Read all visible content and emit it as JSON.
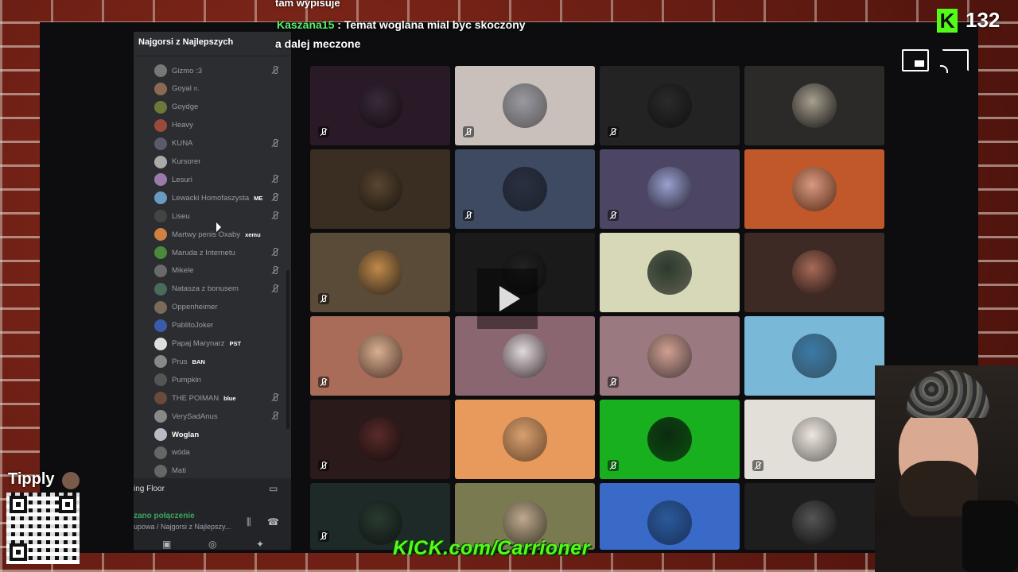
{
  "chat": {
    "line1": "tam wypisuje",
    "line2_user": "Kaszana15",
    "line2_sep": " : ",
    "line2_text": "Temat woglana mial byc skoczony",
    "line3": "a dalej meczone"
  },
  "stream": {
    "viewer_count": "132",
    "kick_logo": "K",
    "url": "KICK.com/Carrioner",
    "tipply": "Tipply"
  },
  "sidebar": {
    "server_title": "Najgorsi z Najlepszych",
    "members": [
      {
        "name": "Gizmo :3",
        "muted": true,
        "color": "#777"
      },
      {
        "name": "Goyal 𝔫.",
        "muted": false,
        "color": "#8a6a55"
      },
      {
        "name": "Goydge",
        "muted": false,
        "color": "#6a7a3a"
      },
      {
        "name": "Heavy",
        "muted": false,
        "color": "#9a4a3a"
      },
      {
        "name": "KUNA",
        "muted": true,
        "color": "#5a5a6a"
      },
      {
        "name": "Kursorer",
        "muted": false,
        "color": "#aaa"
      },
      {
        "name": "Lesuri",
        "muted": true,
        "color": "#9a7aaa"
      },
      {
        "name": "Lewacki Homofaszysta",
        "muted": true,
        "color": "#6a9abf",
        "tag": "ME"
      },
      {
        "name": "Liseu",
        "muted": true,
        "color": "#444"
      },
      {
        "name": "Martwy penis Oxaby",
        "muted": false,
        "color": "#d08040",
        "tag": "xemu"
      },
      {
        "name": "Maruda z Internetu",
        "muted": true,
        "color": "#4a8a3a"
      },
      {
        "name": "Mikele",
        "muted": true,
        "color": "#6a6a6a"
      },
      {
        "name": "Natasza z bonusem",
        "muted": true,
        "color": "#4a6a5a"
      },
      {
        "name": "Oppenheimer",
        "muted": false,
        "color": "#7a6a5a"
      },
      {
        "name": "PablitoJoker",
        "muted": false,
        "color": "#3a5aaa"
      },
      {
        "name": "Papaj Marynarz",
        "muted": false,
        "color": "#ddd",
        "tag": "PST"
      },
      {
        "name": "Prus",
        "muted": false,
        "color": "#888",
        "tag": "BAN"
      },
      {
        "name": "Pumpkin",
        "muted": false,
        "color": "#555"
      },
      {
        "name": "THE POIMAN",
        "muted": true,
        "color": "#6a4a3a",
        "tag": "blue"
      },
      {
        "name": "VerySadAnus",
        "muted": true,
        "color": "#888"
      },
      {
        "name": "Woglan",
        "muted": false,
        "color": "#b8bcc4",
        "bold": true
      },
      {
        "name": "wóda",
        "muted": false,
        "color": "#666"
      },
      {
        "name": "Mati",
        "muted": false,
        "color": "#666"
      }
    ],
    "stage_label": "ing Floor",
    "connection_status": "zano połączenie",
    "connection_channel": "upowa / Najgorsi z Najlepszy..."
  },
  "tiles": [
    {
      "bg": "#2a1a28",
      "av": "#3a2a3a",
      "muted": true
    },
    {
      "bg": "#c9c0bb",
      "av": "#9a9aa2",
      "muted": true
    },
    {
      "bg": "#232323",
      "av": "#2b2b2b",
      "muted": true
    },
    {
      "bg": "#2b2a28",
      "av": "#a8a090",
      "muted": false
    },
    {
      "bg": "#3a2e22",
      "av": "#5a4630",
      "muted": false
    },
    {
      "bg": "#3e4a62",
      "av": "#2a3040",
      "muted": true
    },
    {
      "bg": "#4c4664",
      "av": "#9aa0d0",
      "muted": true
    },
    {
      "bg": "#c0582a",
      "av": "#d89a80",
      "muted": false
    },
    {
      "bg": "#5a4a38",
      "av": "#c08a4a",
      "muted": true
    },
    {
      "bg": "#1a1a1a",
      "av": "#222",
      "muted": false
    },
    {
      "bg": "#d6d8b8",
      "av": "#2c3a2c",
      "muted": false
    },
    {
      "bg": "#3e2a24",
      "av": "#a86a58",
      "muted": false
    },
    {
      "bg": "#a86c58",
      "av": "#d8b090",
      "muted": true
    },
    {
      "bg": "#8a6670",
      "av": "#e0dadd",
      "muted": false
    },
    {
      "bg": "#9a7a80",
      "av": "#d0a090",
      "muted": true
    },
    {
      "bg": "#7ab8d8",
      "av": "#3a7aa8",
      "muted": false
    },
    {
      "bg": "#2a1a1a",
      "av": "#5a2a2a",
      "muted": true
    },
    {
      "bg": "#e89a5c",
      "av": "#d8a070",
      "muted": false
    },
    {
      "bg": "#19b020",
      "av": "#0c2a10",
      "muted": true
    },
    {
      "bg": "#e2dfd8",
      "av": "#efe8e0",
      "muted": true
    },
    {
      "bg": "#1e2a28",
      "av": "#2a3a30",
      "muted": true
    },
    {
      "bg": "#7a7a50",
      "av": "#c0a890",
      "muted": false
    },
    {
      "bg": "#3a6ac8",
      "av": "#2a5a9a",
      "muted": false
    },
    {
      "bg": "#1e1e1e",
      "av": "#555",
      "muted": false
    }
  ]
}
